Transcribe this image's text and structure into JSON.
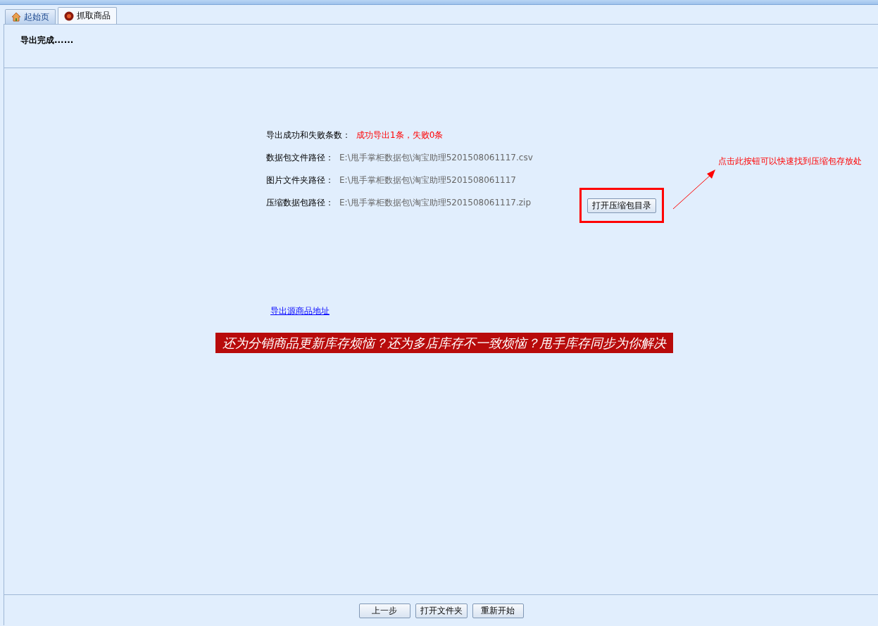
{
  "tabs": [
    {
      "label": "起始页",
      "kind": "home",
      "selected": false
    },
    {
      "label": "抓取商品",
      "kind": "badge",
      "selected": true
    }
  ],
  "status": "导出完成......",
  "summary": {
    "label": "导出成功和失败条数：",
    "value": "成功导出1条，失败0条"
  },
  "paths": [
    {
      "label": "数据包文件路径：",
      "value": "E:\\甩手掌柜数据包\\淘宝助理5201508061117.csv"
    },
    {
      "label": "图片文件夹路径：",
      "value": "E:\\甩手掌柜数据包\\淘宝助理5201508061117"
    },
    {
      "label": "压缩数据包路径：",
      "value": "E:\\甩手掌柜数据包\\淘宝助理5201508061117.zip"
    }
  ],
  "open_zip_button": "打开压缩包目录",
  "annotation": "点击此按钮可以快速找到压缩包存放处",
  "source_link": "导出源商品地址",
  "banner": "还为分销商品更新库存烦恼？还为多店库存不一致烦恼？甩手库存同步为你解决",
  "footer_buttons": [
    "上一步",
    "打开文件夹",
    "重新开始"
  ]
}
